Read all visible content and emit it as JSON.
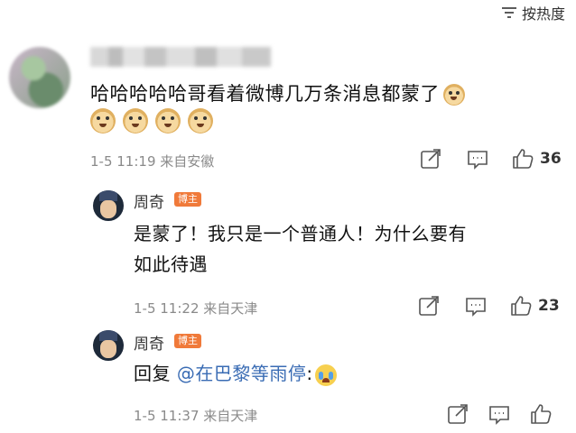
{
  "header": {
    "sort_label": "按热度",
    "sort_icon": "sort-lines-icon"
  },
  "main_comment": {
    "text": "哈哈哈哈哈哥看着微博几万条消息都蒙了",
    "emoji_count_inline": 1,
    "emoji_row_count": 4,
    "time": "1-5 11:19",
    "location": "来自安徽",
    "likes": "36"
  },
  "replies": [
    {
      "name": "周奇",
      "badge": "博主",
      "line1": "是蒙了！我只是一个普通人！为什么要有",
      "line2": "如此待遇",
      "time": "1-5 11:22",
      "location": "来自天津",
      "likes": "23"
    },
    {
      "name": "周奇",
      "badge": "博主",
      "prefix": "回复",
      "mention": "@在巴黎等雨停",
      "suffix": ":",
      "time": "1-5 11:37",
      "location": "来自天津",
      "likes": ""
    }
  ],
  "colors": {
    "mention": "#3a6cb4",
    "badge": "#f07a3a",
    "meta": "#8a8a8a"
  }
}
